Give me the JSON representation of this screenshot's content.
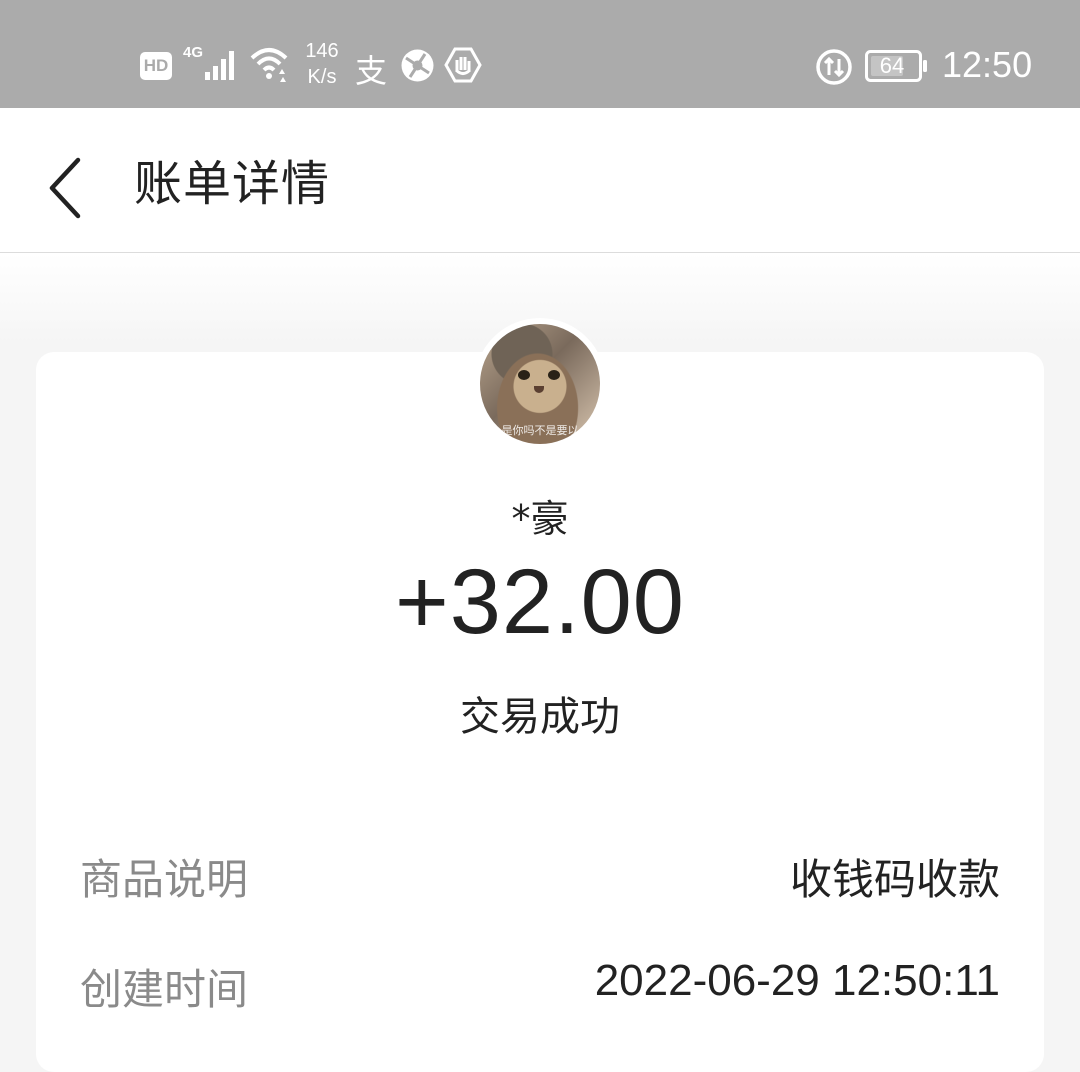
{
  "status_bar": {
    "hd": "HD",
    "network": "4G",
    "speed_value": "146",
    "speed_unit": "K/s",
    "app_glyph": "支",
    "battery": "64",
    "time": "12:50",
    "icons": [
      "hd-icon",
      "signal-icon",
      "wifi-icon",
      "alipay-icon",
      "circle-app-icon",
      "hexagon-app-icon",
      "data-saver-icon",
      "battery-icon"
    ]
  },
  "header": {
    "title": "账单详情",
    "back_icon": "chevron-left-icon"
  },
  "transaction": {
    "avatar_caption": "是你吗不是要以",
    "payer": "*豪",
    "amount": "+32.00",
    "status": "交易成功"
  },
  "details": [
    {
      "label": "商品说明",
      "value": "收钱码收款"
    },
    {
      "label": "创建时间",
      "value": "2022-06-29 12:50:11"
    }
  ],
  "colors": {
    "status_bar_bg": "#ababab",
    "page_bg": "#f5f5f5",
    "card_bg": "#ffffff",
    "text_primary": "#222222",
    "text_secondary": "#8a8a8a"
  }
}
